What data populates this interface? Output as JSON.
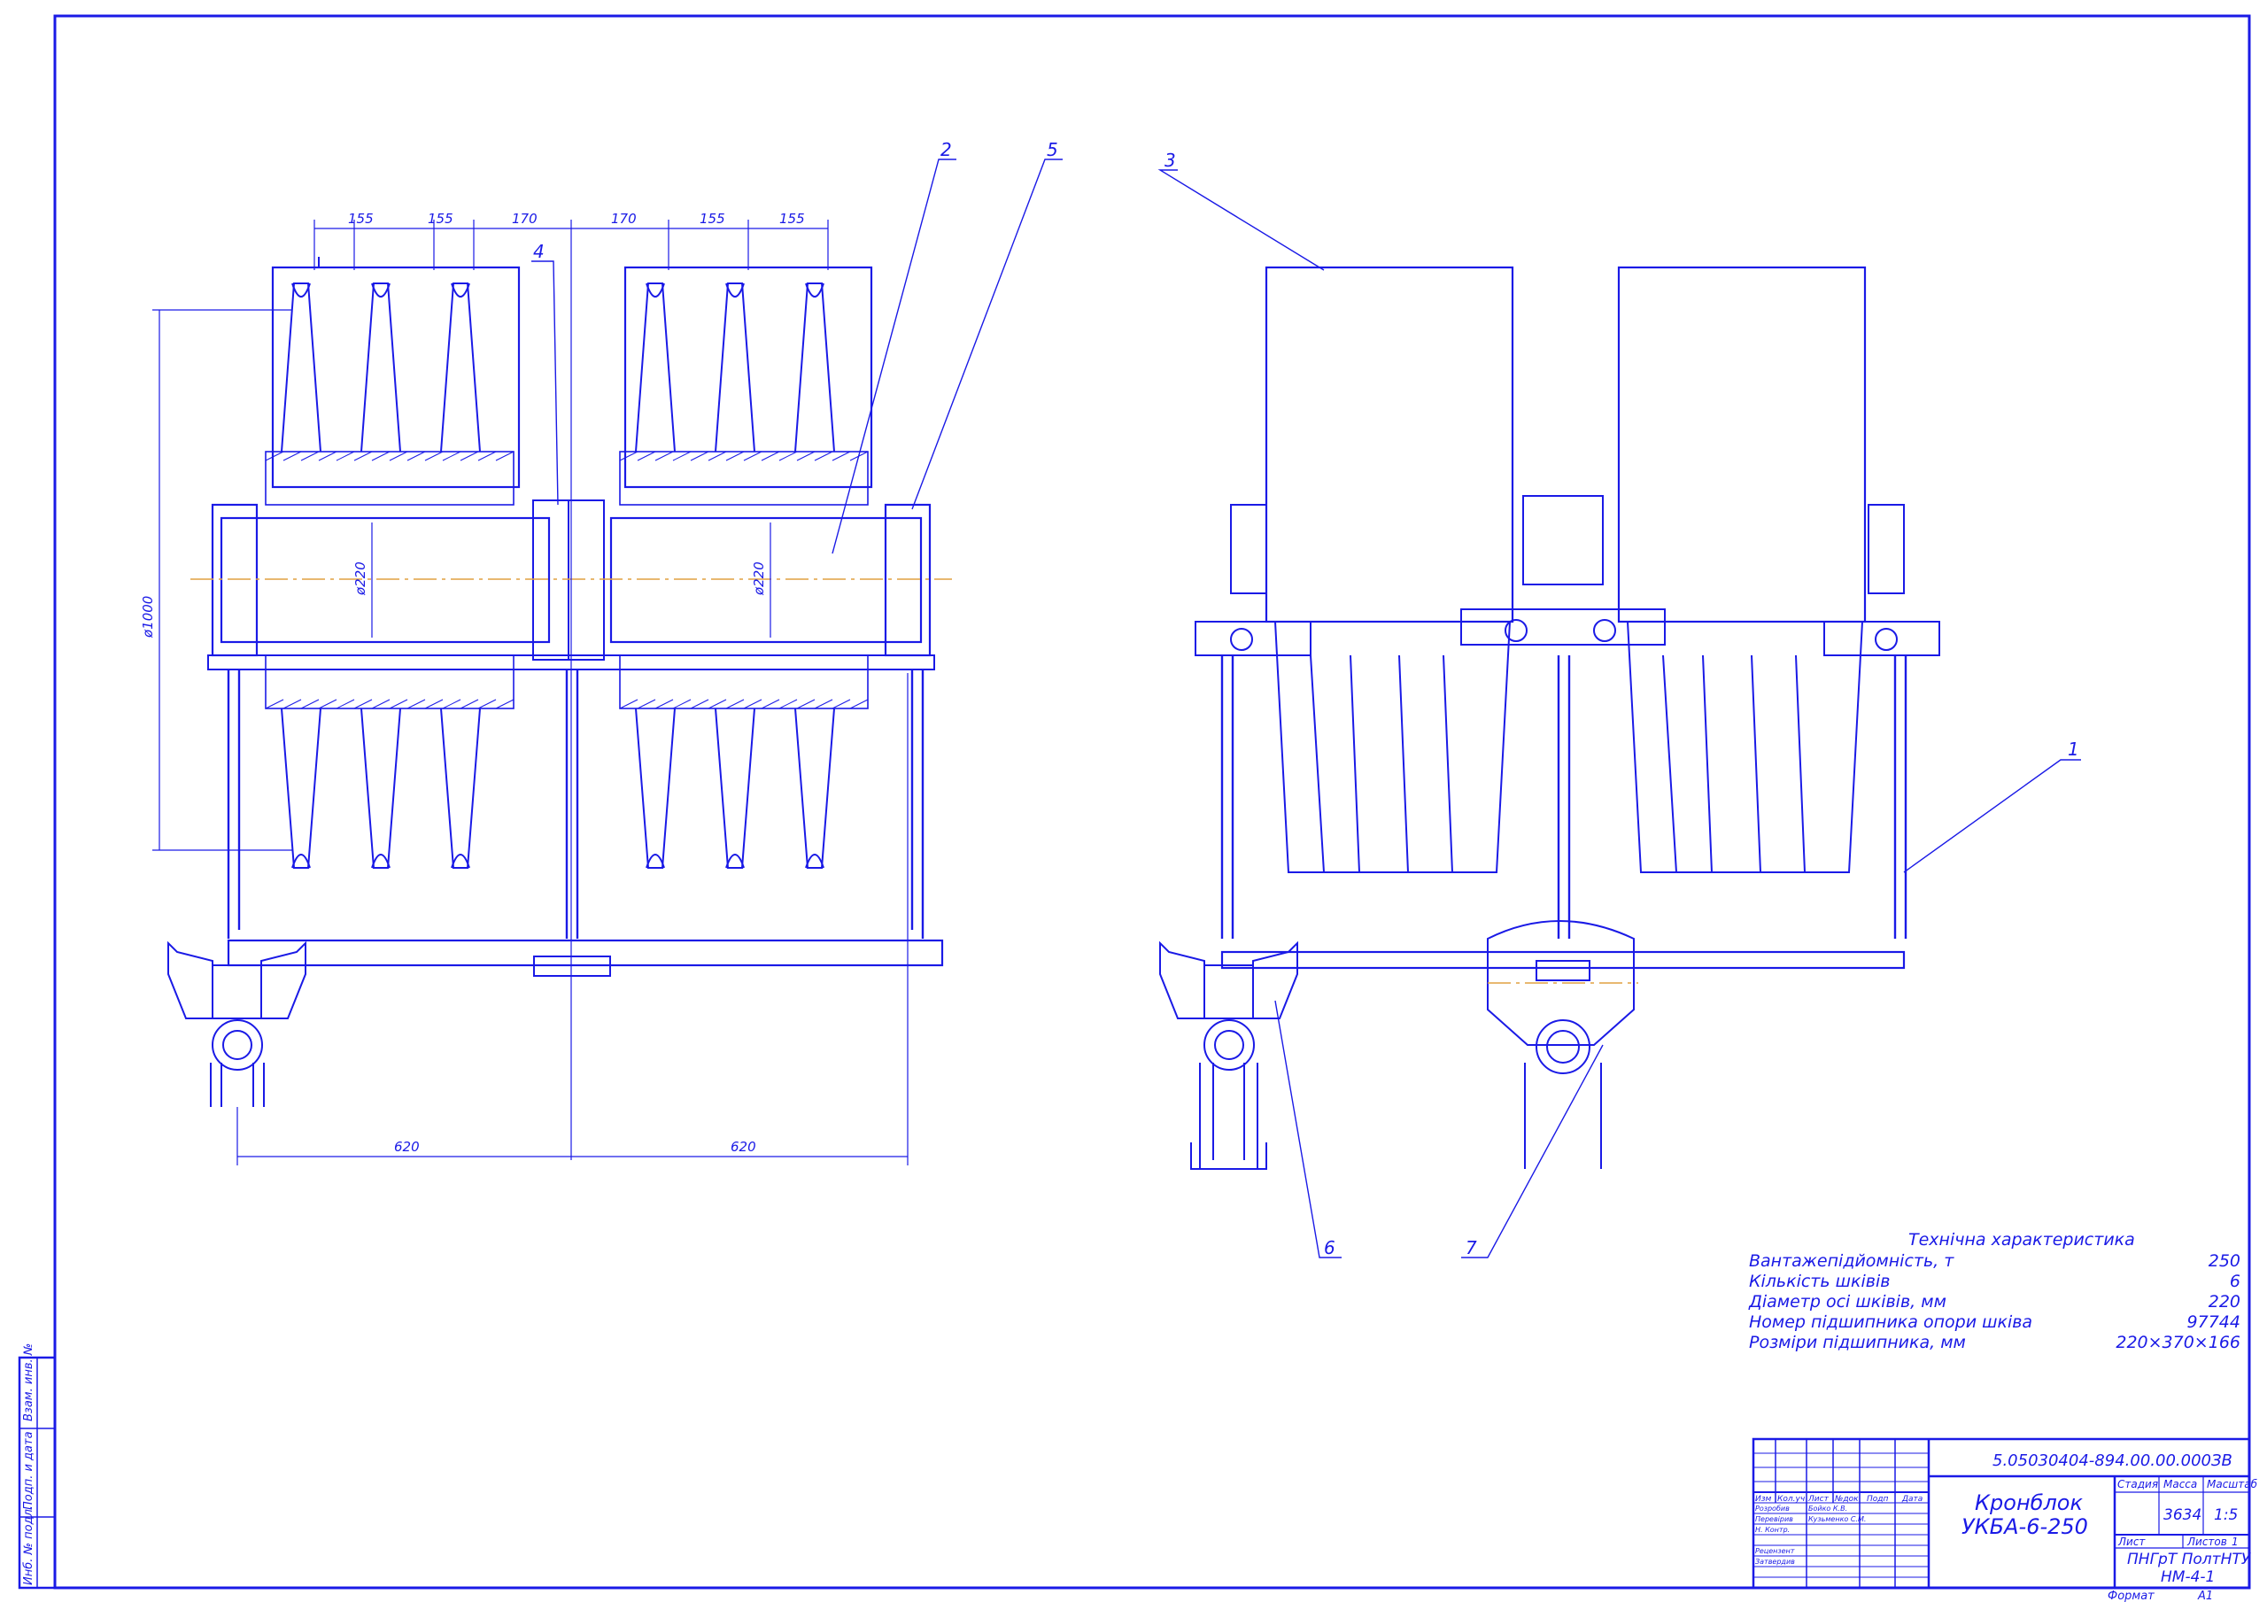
{
  "drawing": {
    "dimensions": {
      "top_left": [
        "155",
        "155",
        "170"
      ],
      "top_right": [
        "170",
        "155",
        "155"
      ],
      "diameter_sheave": "ø1000",
      "diameter_axle_left": "ø220",
      "diameter_axle_right": "ø220",
      "bottom_left": "620",
      "bottom_right": "620"
    },
    "callouts": [
      "1",
      "2",
      "3",
      "4",
      "5",
      "6",
      "7"
    ]
  },
  "tech": {
    "title": "Технічна характеристика",
    "rows": [
      {
        "label": "Вантажепідйомність, т",
        "value": "250"
      },
      {
        "label": "Кількість шківів",
        "value": "6"
      },
      {
        "label": "Діаметр осі шківів, мм",
        "value": "220"
      },
      {
        "label": "Номер підшипника опори шківа",
        "value": "97744"
      },
      {
        "label": "Розміри підшипника, мм",
        "value": "220×370×166"
      }
    ]
  },
  "titleblock": {
    "code": "5.05030404-894.00.00.000ЗВ",
    "name_line1": "Кронблок",
    "name_line2": "УКБА-6-250",
    "headers": [
      "Изм",
      "Кол.уч",
      "Лист",
      "№док",
      "Подп",
      "Дата"
    ],
    "roles": [
      "Розробив",
      "Перевірив",
      "Н. Контр.",
      "Рецензент",
      "Затвердив"
    ],
    "names": [
      "Бойко К.В.",
      "Кузьменко С.М."
    ],
    "stage_label": "Стадия",
    "mass_label": "Масса",
    "scale_label": "Масштаб",
    "mass_value": "3634",
    "scale_value": "1:5",
    "sheet_label": "Лист",
    "sheets_label": "Листов",
    "sheets_value": "1",
    "org_line1": "ПНГрТ ПолтНТУ",
    "org_line2": "НМ-4-1",
    "format_label": "Формат",
    "format_value": "А1"
  },
  "side_stamp": [
    "Инб. № подл.",
    "Подп. и дата",
    "Взам. инв. №"
  ]
}
